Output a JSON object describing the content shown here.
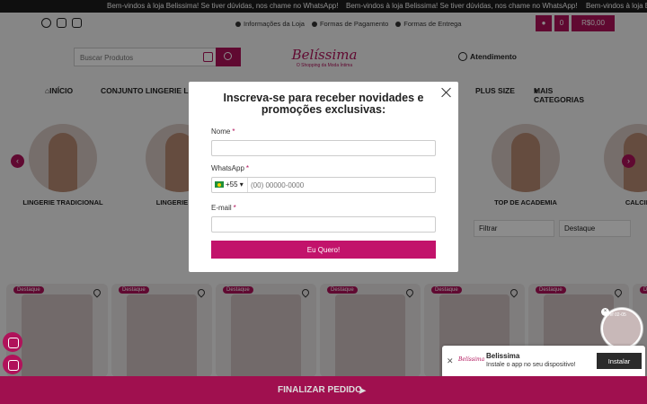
{
  "marquee": {
    "items": [
      "Bem-vindos à loja Belissima! Se tiver dúvidas, nos chame no WhatsApp!",
      "Bem-vindos à loja Belissima! Se tiver dúvidas, nos chame no WhatsApp!",
      "Bem-vindos à loja Belissima! Se tiver dúvidas, nos chame no WhatsApp!"
    ]
  },
  "social_icons": [
    "whatsapp-icon",
    "facebook-icon",
    "instagram-icon"
  ],
  "info_links": [
    "Informações da Loja",
    "Formas de Pagamento",
    "Formas de Entrega"
  ],
  "cart": {
    "count": "0",
    "total": "R$0,00"
  },
  "search": {
    "placeholder": "Buscar Produtos"
  },
  "logo": {
    "name": "Belíssima",
    "tagline": "O Shopping da Moda Íntima"
  },
  "atendimento": "Atendimento",
  "nav": {
    "items": [
      "INÍCIO",
      "CONJUNTO LINGERIE LUXO",
      "PLUS SIZE",
      "MAIS CATEGORIAS"
    ]
  },
  "categories": [
    "LINGERIE TRADICIONAL",
    "LINGERIE BEL",
    "TOP DE ACADEMIA",
    "CALCIN"
  ],
  "filters": {
    "filter_label": "Filtrar",
    "sort_label": "Destaque"
  },
  "products": {
    "badge": "Destaque"
  },
  "modal": {
    "title": "Inscreva-se para receber novidades e promoções exclusivas:",
    "name_label": "Nome",
    "whatsapp_label": "WhatsApp",
    "phone_prefix": "+55",
    "phone_placeholder": "(00) 00000-0000",
    "email_label": "E-mail",
    "required_mark": "*",
    "submit_label": "Eu Quero!"
  },
  "toast": {
    "mini_logo": "Belíssima",
    "title": "Belissima",
    "subtitle": "Instale o app no seu dispositivo!",
    "install_label": "Instalar"
  },
  "story": {
    "caption": "#ref 02-05"
  },
  "bottom_bar": {
    "label": "FINALIZAR PEDIDO"
  },
  "colors": {
    "brand": "#b0125a",
    "bottom_bar": "#a0104f",
    "overlay": "rgba(0,0,0,0.45)"
  }
}
